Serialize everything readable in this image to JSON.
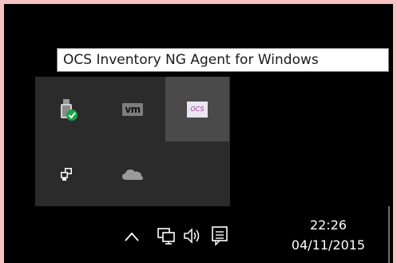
{
  "tooltip": {
    "text": "OCS Inventory NG Agent for Windows"
  },
  "tray": {
    "icons": [
      {
        "name": "usb-device-icon",
        "hint": "safely remove hardware"
      },
      {
        "name": "vmware-icon",
        "label": "vm"
      },
      {
        "name": "ocs-inventory-icon",
        "label": "OCS"
      },
      {
        "name": "network-devices-icon"
      },
      {
        "name": "onedrive-cloud-icon"
      }
    ]
  },
  "taskbar": {
    "chevron": "^",
    "time": "22:26",
    "date": "04/11/2015"
  }
}
